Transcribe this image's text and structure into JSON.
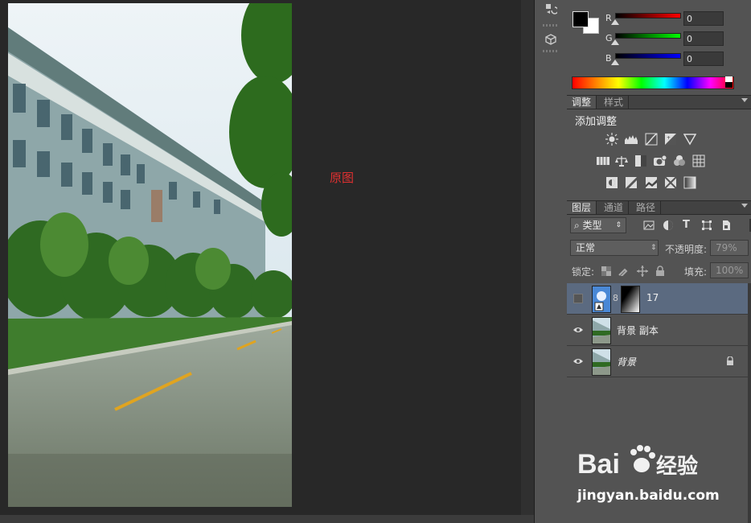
{
  "canvas": {
    "label": "原图"
  },
  "color_panel": {
    "channels": [
      {
        "name": "R",
        "value": "0"
      },
      {
        "name": "G",
        "value": "0"
      },
      {
        "name": "B",
        "value": "0"
      }
    ],
    "colors": {
      "foreground": "#000000",
      "background": "#ffffff"
    }
  },
  "adjustments": {
    "tabs": [
      "调整",
      "样式"
    ],
    "title": "添加调整"
  },
  "layers": {
    "tabs": [
      "图层",
      "通道",
      "路径"
    ],
    "filter": {
      "label": "类型"
    },
    "blend_mode": "正常",
    "opacity": {
      "label": "不透明度:",
      "value": "79%"
    },
    "lock": {
      "label": "锁定:"
    },
    "fill": {
      "label": "填充:",
      "value": "100%"
    },
    "items": [
      {
        "name": "17",
        "visible": false,
        "selected": true,
        "type": "adjustment"
      },
      {
        "name": "背景 副本",
        "visible": true,
        "selected": false,
        "type": "image"
      },
      {
        "name": "背景",
        "visible": true,
        "selected": false,
        "type": "image",
        "locked": true
      }
    ]
  },
  "watermark": {
    "brand": "Bai 经验",
    "url": "jingyan.baidu.com"
  }
}
